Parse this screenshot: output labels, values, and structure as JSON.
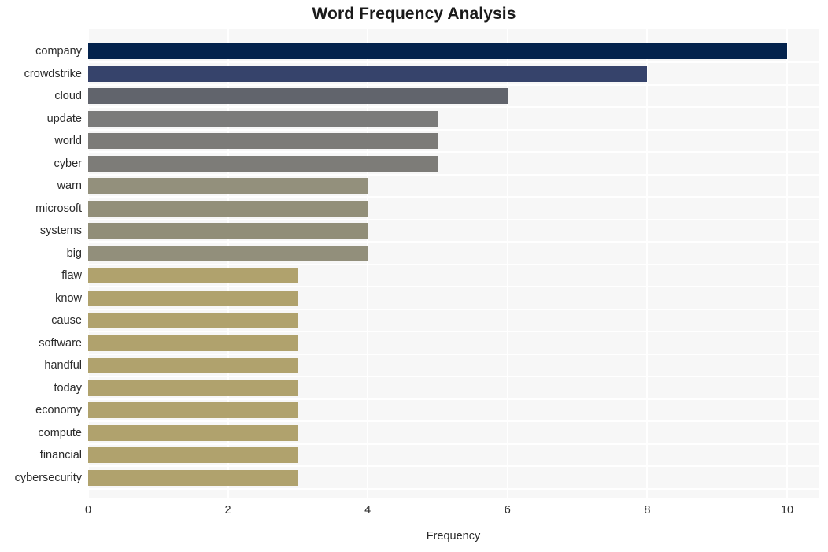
{
  "chart_data": {
    "type": "bar",
    "orientation": "horizontal",
    "title": "Word Frequency Analysis",
    "xlabel": "Frequency",
    "ylabel": "",
    "categories": [
      "company",
      "crowdstrike",
      "cloud",
      "update",
      "world",
      "cyber",
      "warn",
      "microsoft",
      "systems",
      "big",
      "flaw",
      "know",
      "cause",
      "software",
      "handful",
      "today",
      "economy",
      "compute",
      "financial",
      "cybersecurity"
    ],
    "values": [
      10,
      8,
      6,
      5,
      5,
      5,
      4,
      4,
      4,
      4,
      3,
      3,
      3,
      3,
      3,
      3,
      3,
      3,
      3,
      3
    ],
    "bar_colors": [
      "#04234d",
      "#36436b",
      "#61646c",
      "#7b7b7a",
      "#7c7b78",
      "#7d7c78",
      "#93907c",
      "#928f79",
      "#918e78",
      "#928f7b",
      "#b0a26d",
      "#b0a26d",
      "#b0a26d",
      "#b0a26d",
      "#b0a26d",
      "#b0a26d",
      "#b0a26d",
      "#b0a26d",
      "#b0a26d",
      "#b0a26d"
    ],
    "xlim": [
      0,
      10.45
    ],
    "xticks": [
      0,
      2,
      4,
      6,
      8,
      10
    ],
    "xtick_labels": [
      "0",
      "2",
      "4",
      "6",
      "8",
      "10"
    ],
    "grid": true,
    "grid_color": "#ffffff",
    "plot_background": "#f7f7f7",
    "figure_background": "#ffffff",
    "legend": null
  }
}
